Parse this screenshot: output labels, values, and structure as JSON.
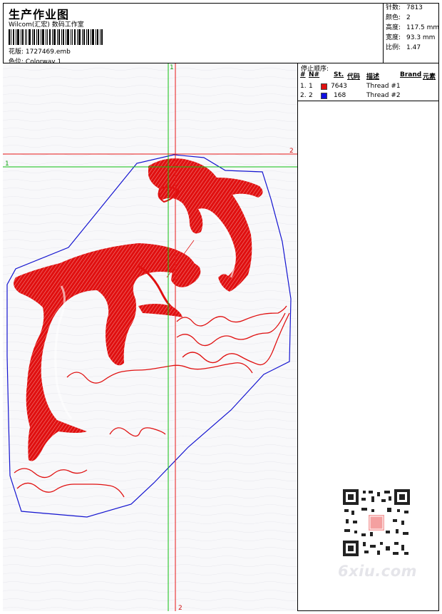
{
  "header": {
    "title": "生产作业图",
    "company": "Wilcom(汇宏) 数码工作室",
    "design_label": "花版:",
    "design_value": "1727469.emb",
    "colorway_label": "色位:",
    "colorway_value": "Colorway 1"
  },
  "stats": [
    {
      "label": "针数:",
      "value": "7813"
    },
    {
      "label": "颜色:",
      "value": "2"
    },
    {
      "label": "高度:",
      "value": "117.5 mm"
    },
    {
      "label": "宽度:",
      "value": "93.3 mm"
    },
    {
      "label": "比例:",
      "value": "1.47"
    }
  ],
  "stop_sequence": {
    "title": "停止顺序:",
    "headers": {
      "hash": "#",
      "n": "N#",
      "st": "St.",
      "code": "代码",
      "desc": "描述",
      "brand": "Brand",
      "element": "元素"
    },
    "rows": [
      {
        "index": "1.",
        "n": "1",
        "color": "#e01010",
        "code": "7643",
        "desc": "Thread #1"
      },
      {
        "index": "2.",
        "n": "2",
        "color": "#1010e0",
        "code": "168",
        "desc": "Thread #2"
      }
    ]
  },
  "canvas": {
    "crosshair_labels": {
      "v1": "1",
      "v2": "2",
      "h1": "1",
      "h2": "2"
    },
    "colors": {
      "red": "#e01010",
      "blue": "#1414d0",
      "green": "#10c010",
      "line_red": "#e81818"
    }
  },
  "watermark": "6xiu.com"
}
